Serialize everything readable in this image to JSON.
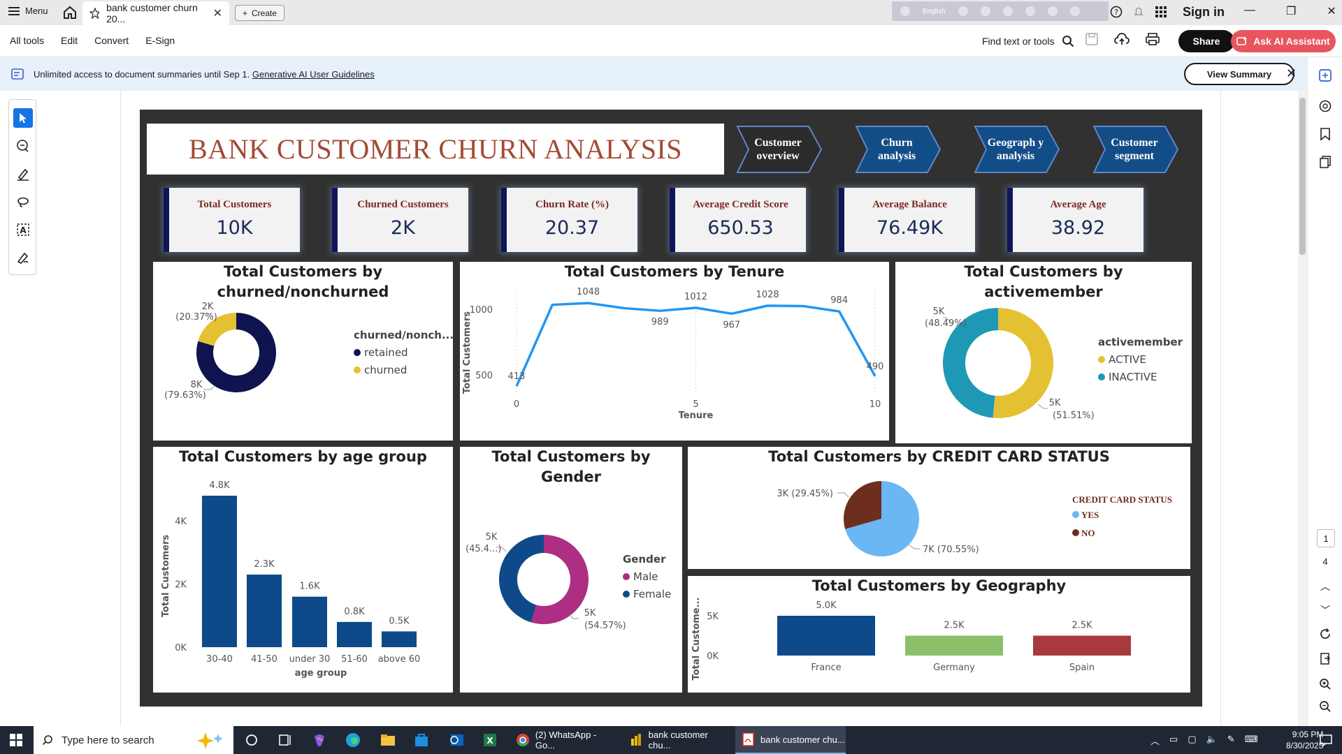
{
  "browser": {
    "menu_label": "Menu",
    "tab_title": "bank customer churn 20...",
    "create_label": "Create",
    "lang_label": "English",
    "signin_label": "Sign in"
  },
  "toolbar": {
    "menus": [
      "All tools",
      "Edit",
      "Convert",
      "E-Sign"
    ],
    "find_label": "Find text or tools",
    "share_label": "Share",
    "ai_label": "Ask AI Assistant"
  },
  "banner": {
    "text": "Unlimited access to document summaries until Sep 1.",
    "link": "Generative AI User Guidelines",
    "view_summary": "View Summary"
  },
  "page_nav": {
    "current": "1",
    "total": "4"
  },
  "dashboard": {
    "title": "BANK CUSTOMER CHURN ANALYSIS",
    "nav": [
      "Customer overview",
      "Churn analysis",
      "Geograph y analysis",
      "Customer segment"
    ],
    "kpis": [
      {
        "label": "Total Customers",
        "value": "10K"
      },
      {
        "label": "Churned Customers",
        "value": "2K"
      },
      {
        "label": "Churn Rate (%)",
        "value": "20.37"
      },
      {
        "label": "Average Credit Score",
        "value": "650.53"
      },
      {
        "label": "Average Balance",
        "value": "76.49K"
      },
      {
        "label": "Average Age",
        "value": "38.92"
      }
    ],
    "colors": {
      "navy": "#0f1450",
      "gold": "#e3c133",
      "teal": "#1f98b6",
      "line": "#2196f3",
      "magenta": "#ad2e82",
      "blue": "#0e4a8a",
      "light_blue": "#6bb7f4",
      "brown": "#6d2e1e",
      "green": "#8cbf6a",
      "red": "#a83a3e",
      "title_red": "#a44a33"
    }
  },
  "chart_data": [
    {
      "type": "pie",
      "title": "Total Customers by churned/nonchurned",
      "legend_title": "churned/nonch...",
      "categories": [
        "retained",
        "churned"
      ],
      "values": [
        79.63,
        20.37
      ],
      "labels": [
        "8K",
        "2K"
      ],
      "pct_labels": [
        "(79.63%)",
        "(20.37%)"
      ],
      "colors": [
        "#0f1450",
        "#e3c133"
      ]
    },
    {
      "type": "line",
      "title": "Total Customers by Tenure",
      "xlabel": "Tenure",
      "ylabel": "Total Customers",
      "x": [
        0,
        1,
        2,
        3,
        4,
        5,
        6,
        7,
        8,
        9,
        10
      ],
      "y": [
        413,
        1035,
        1048,
        1009,
        989,
        1012,
        967,
        1028,
        1025,
        984,
        490
      ],
      "data_labels": [
        {
          "x": 0,
          "text": "413"
        },
        {
          "x": 2,
          "text": "1048"
        },
        {
          "x": 4,
          "text": "989"
        },
        {
          "x": 5,
          "text": "1012"
        },
        {
          "x": 6,
          "text": "967"
        },
        {
          "x": 7,
          "text": "1028"
        },
        {
          "x": 9,
          "text": "984"
        },
        {
          "x": 10,
          "text": "490"
        }
      ],
      "xticks": [
        "0",
        "5",
        "10"
      ],
      "yticks": [
        "500",
        "1000"
      ],
      "ylim": [
        350,
        1150
      ]
    },
    {
      "type": "pie",
      "title": "Total Customers by activemember",
      "legend_title": "activemember",
      "categories": [
        "ACTIVE",
        "INACTIVE"
      ],
      "values": [
        51.51,
        48.49
      ],
      "labels": [
        "5K",
        "5K"
      ],
      "pct_labels": [
        "(51.51%)",
        "(48.49%)"
      ],
      "colors": [
        "#e3c133",
        "#1f98b6"
      ]
    },
    {
      "type": "bar",
      "title": "Total Customers by age group",
      "xlabel": "age group",
      "ylabel": "Total Customers",
      "categories": [
        "30-40",
        "41-50",
        "under 30",
        "51-60",
        "above 60"
      ],
      "values": [
        4.8,
        2.3,
        1.6,
        0.8,
        0.5
      ],
      "data_labels": [
        "4.8K",
        "2.3K",
        "1.6K",
        "0.8K",
        "0.5K"
      ],
      "yticks": [
        "0K",
        "2K",
        "4K"
      ],
      "ylim": [
        0,
        5
      ],
      "color": "#0e4a8a"
    },
    {
      "type": "pie",
      "title": "Total Customers by Gender",
      "legend_title": "Gender",
      "categories": [
        "Male",
        "Female"
      ],
      "values": [
        54.57,
        45.43
      ],
      "labels": [
        "5K",
        "5K"
      ],
      "pct_labels": [
        "(54.57%)",
        "(45.4...)"
      ],
      "colors": [
        "#ad2e82",
        "#0e4a8a"
      ]
    },
    {
      "type": "pie",
      "title": "Total Customers by CREDIT CARD STATUS",
      "legend_title": "CREDIT CARD STATUS",
      "categories": [
        "YES",
        "NO"
      ],
      "values": [
        70.55,
        29.45
      ],
      "labels": [
        "7K (70.55%)",
        "3K (29.45%)"
      ],
      "colors": [
        "#6bb7f4",
        "#6d2e1e"
      ]
    },
    {
      "type": "bar",
      "title": "Total Customers by Geography",
      "ylabel": "Total Custome...",
      "categories": [
        "France",
        "Germany",
        "Spain"
      ],
      "values": [
        5.0,
        2.5,
        2.5
      ],
      "data_labels": [
        "5.0K",
        "2.5K",
        "2.5K"
      ],
      "yticks": [
        "0K",
        "5K"
      ],
      "ylim": [
        0,
        5
      ],
      "colors": [
        "#0e4a8a",
        "#8cbf6a",
        "#a83a3e"
      ]
    }
  ],
  "taskbar": {
    "search_placeholder": "Type here to search",
    "apps": [
      "(2) WhatsApp - Go...",
      "bank customer chu...",
      "bank customer chu..."
    ],
    "time": "9:05 PM",
    "date": "8/30/2025"
  }
}
